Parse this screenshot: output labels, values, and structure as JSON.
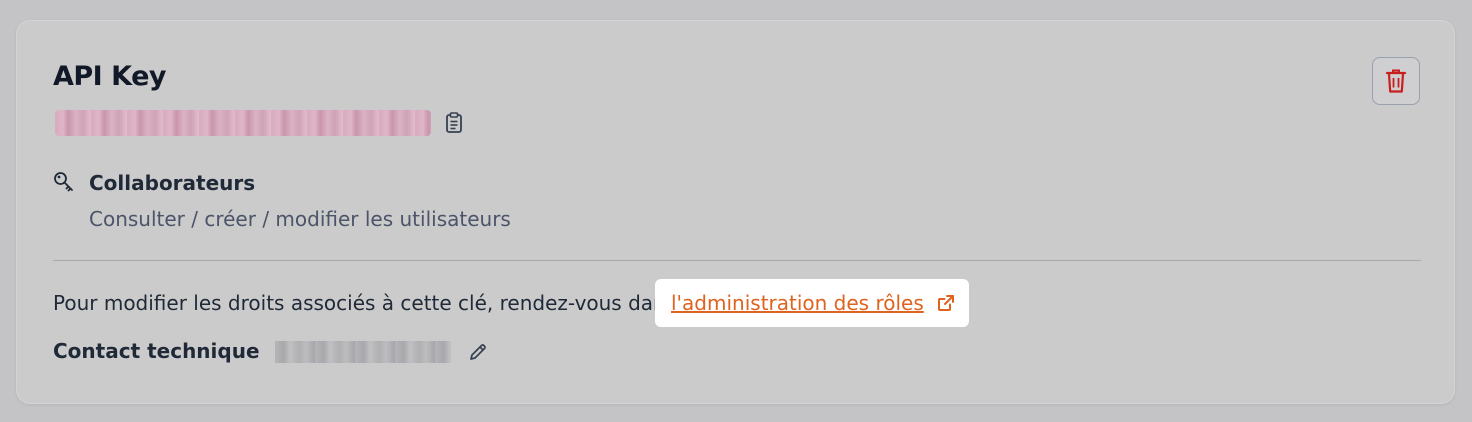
{
  "card": {
    "title": "API Key",
    "permission": {
      "title": "Collaborateurs",
      "description": "Consulter / créer / modifier les utilisateurs",
      "icon": "key-icon"
    },
    "info_text": "Pour modifier les droits associés à cette clé, rendez-vous dans",
    "roles_link": "l'administration des rôles",
    "contact_label": "Contact technique",
    "icons": {
      "copy": "clipboard-icon",
      "delete": "trash-icon",
      "external": "external-link-icon",
      "edit": "pencil-icon"
    }
  },
  "colors": {
    "accent_link": "#e0621f",
    "danger": "#c81e1e"
  }
}
